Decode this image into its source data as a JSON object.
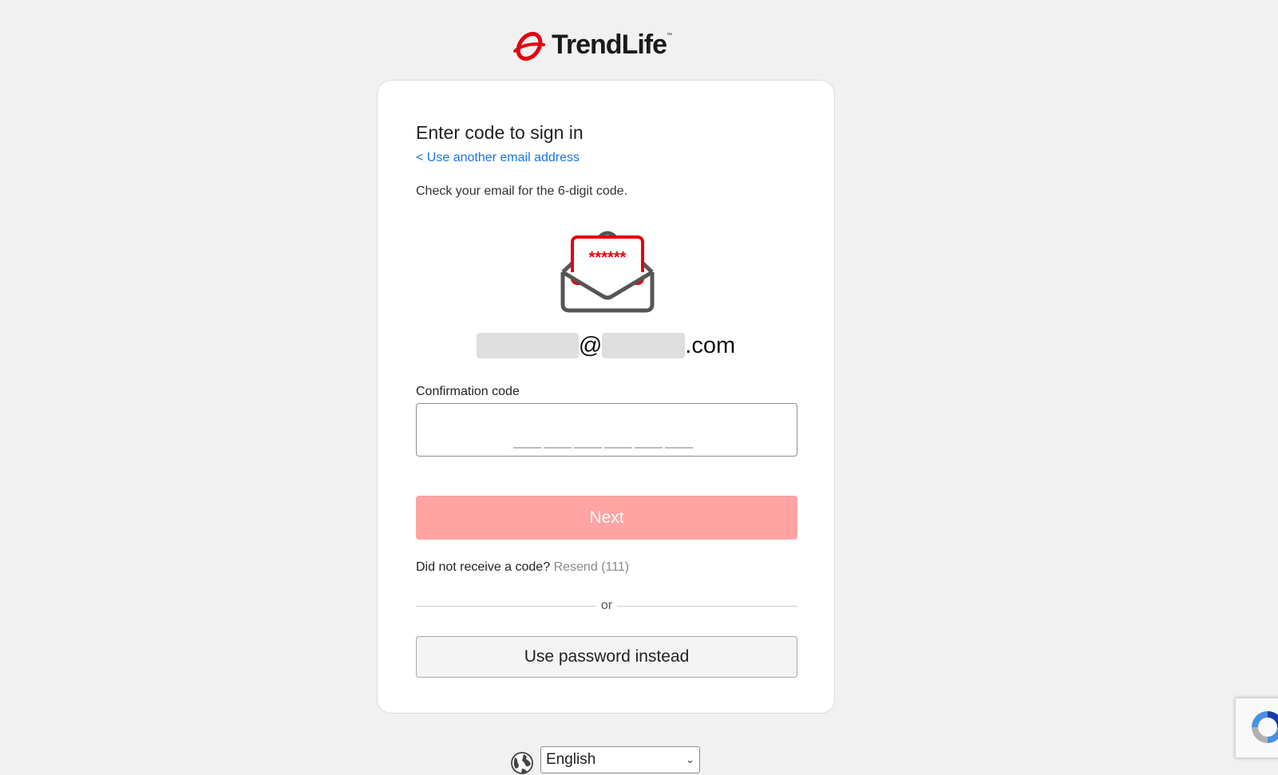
{
  "brand": {
    "name": "TrendLife",
    "trademark": "™",
    "accent_color": "#e3000f"
  },
  "card": {
    "title": "Enter code to sign in",
    "back_link": "< Use another email address",
    "instruction": "Check your email for the 6-digit code.",
    "email": {
      "at_sign": "@",
      "suffix": ".com",
      "redacted": true
    },
    "envelope_code_mask": "******",
    "code_field": {
      "label": "Confirmation code",
      "value": "",
      "digit_slots": 6
    },
    "next_button": {
      "label": "Next",
      "enabled": false,
      "color": "#ffa3a3"
    },
    "resend": {
      "prompt": "Did not receive a code?",
      "link_label": "Resend (111)"
    },
    "divider_text": "or",
    "password_button": {
      "label": "Use password instead"
    }
  },
  "language": {
    "selected": "English",
    "icon": "globe-icon"
  },
  "recaptcha": {
    "icon": "recaptcha-icon"
  }
}
